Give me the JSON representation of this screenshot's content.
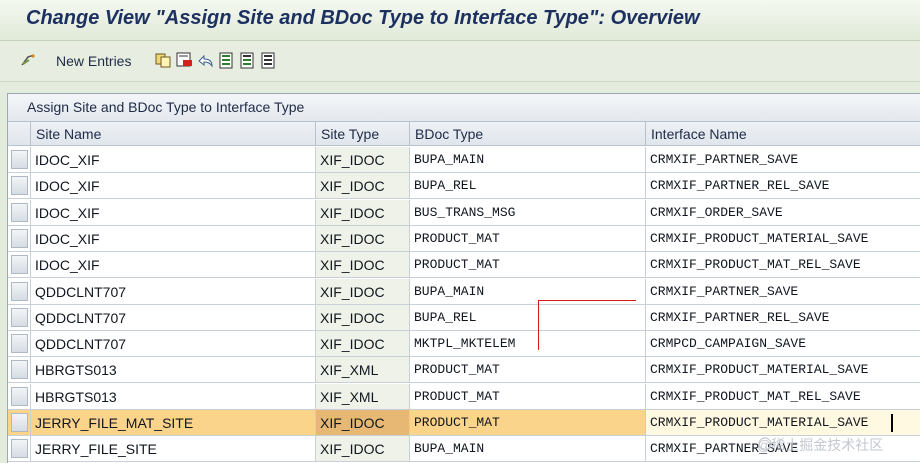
{
  "window": {
    "title": "Change View \"Assign Site and BDoc Type to Interface Type\": Overview"
  },
  "toolbar": {
    "new_entries_label": "New Entries",
    "icons": [
      "glasses-icon",
      "copy-icon",
      "delete-icon",
      "undo-icon",
      "select-all-icon",
      "select-block-icon",
      "deselect-all-icon"
    ]
  },
  "table": {
    "title": "Assign Site and BDoc Type to Interface Type",
    "columns": [
      "Site Name",
      "Site Type",
      "BDoc Type",
      "Interface Name"
    ],
    "rows": [
      {
        "site": "IDOC_XIF",
        "site_type": "XIF_IDOC",
        "bdoc": "BUPA_MAIN",
        "iface": "CRMXIF_PARTNER_SAVE"
      },
      {
        "site": "IDOC_XIF",
        "site_type": "XIF_IDOC",
        "bdoc": "BUPA_REL",
        "iface": "CRMXIF_PARTNER_REL_SAVE"
      },
      {
        "site": "IDOC_XIF",
        "site_type": "XIF_IDOC",
        "bdoc": "BUS_TRANS_MSG",
        "iface": "CRMXIF_ORDER_SAVE"
      },
      {
        "site": "IDOC_XIF",
        "site_type": "XIF_IDOC",
        "bdoc": "PRODUCT_MAT",
        "iface": "CRMXIF_PRODUCT_MATERIAL_SAVE"
      },
      {
        "site": "IDOC_XIF",
        "site_type": "XIF_IDOC",
        "bdoc": "PRODUCT_MAT",
        "iface": "CRMXIF_PRODUCT_MAT_REL_SAVE"
      },
      {
        "site": "QDDCLNT707",
        "site_type": "XIF_IDOC",
        "bdoc": "BUPA_MAIN",
        "iface": "CRMXIF_PARTNER_SAVE"
      },
      {
        "site": "QDDCLNT707",
        "site_type": "XIF_IDOC",
        "bdoc": "BUPA_REL",
        "iface": "CRMXIF_PARTNER_REL_SAVE"
      },
      {
        "site": "QDDCLNT707",
        "site_type": "XIF_IDOC",
        "bdoc": "MKTPL_MKTELEM",
        "iface": "CRMPCD_CAMPAIGN_SAVE"
      },
      {
        "site": "HBRGTS013",
        "site_type": "XIF_XML",
        "bdoc": "PRODUCT_MAT",
        "iface": "CRMXIF_PRODUCT_MATERIAL_SAVE"
      },
      {
        "site": "HBRGTS013",
        "site_type": "XIF_XML",
        "bdoc": "PRODUCT_MAT",
        "iface": "CRMXIF_PRODUCT_MAT_REL_SAVE"
      },
      {
        "site": "JERRY_FILE_MAT_SITE",
        "site_type": "XIF_IDOC",
        "bdoc": "PRODUCT_MAT",
        "iface": "CRMXIF_PRODUCT_MATERIAL_SAVE"
      },
      {
        "site": "JERRY_FILE_SITE",
        "site_type": "XIF_IDOC",
        "bdoc": "BUPA_MAIN",
        "iface": "CRMXIF_PARTNER_SAVE"
      }
    ],
    "highlighted_row": 10
  },
  "watermark": "@稀土掘金技术社区",
  "colors": {
    "title": "#1d3160",
    "highlight": "#fbd48b",
    "marker": "#d21a1a",
    "background": "#e4ecdd"
  }
}
